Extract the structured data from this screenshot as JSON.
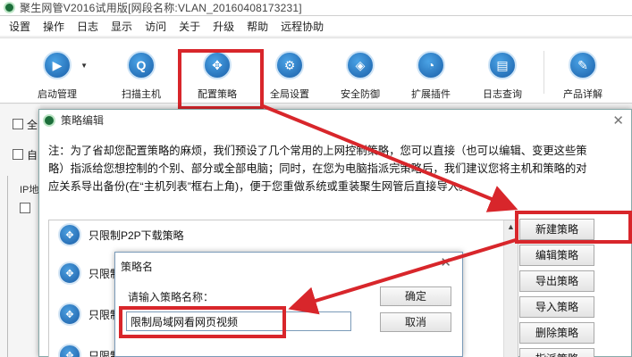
{
  "window": {
    "title": "聚生网管V2016试用版[网段名称:VLAN_20160408173231]"
  },
  "menu": [
    "设置",
    "操作",
    "日志",
    "显示",
    "访问",
    "关于",
    "升级",
    "帮助",
    "远程协助"
  ],
  "toolbar": [
    {
      "label": "启动管理",
      "icon": "play-icon"
    },
    {
      "label": "扫描主机",
      "icon": "scan-icon"
    },
    {
      "label": "配置策略",
      "icon": "strategy-icon"
    },
    {
      "label": "全局设置",
      "icon": "settings-icon"
    },
    {
      "label": "安全防御",
      "icon": "shield-icon"
    },
    {
      "label": "扩展插件",
      "icon": "plugin-icon"
    },
    {
      "label": "日志查询",
      "icon": "log-icon"
    },
    {
      "label": "产品详解",
      "icon": "product-icon"
    }
  ],
  "background": {
    "row1": "全",
    "row2": "自",
    "col": "IP地"
  },
  "dialog": {
    "title": "策略编辑",
    "notice_lines": [
      "注：为了省却您配置策略的麻烦，我们预设了几个常用的上网控制策略，您可以直接（也可以编辑、变更这些策",
      "略）指派给您想控制的个别、部分或全部电脑；同时，在您为电脑指派完策略后，我们建议您将主机和策略的对",
      "应关系导出备份(在“主机列表”框右上角)，便于您重做系统或重装聚生网管后直接导入。"
    ],
    "list_items": [
      "只限制P2P下载策略",
      "只限制",
      "只限制",
      "只限制"
    ],
    "buttons": [
      "新建策略",
      "编辑策略",
      "导出策略",
      "导入策略",
      "删除策略",
      "指派策略"
    ]
  },
  "subdialog": {
    "title": "策略名",
    "prompt": "请输入策略名称：",
    "input_value": "限制局域网看网页视频",
    "ok_label": "确定",
    "cancel_label": "取消"
  },
  "colors": {
    "highlight": "#d8262b",
    "accent": "#1a5fa8"
  }
}
